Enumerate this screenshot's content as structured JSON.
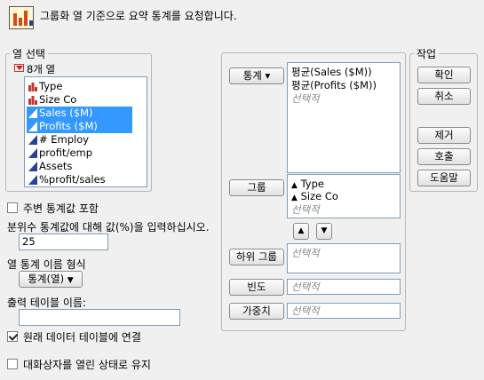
{
  "header": {
    "description": "그룹화 열 기준으로 요약 통계를 요청합니다."
  },
  "column_select": {
    "legend": "열 선택",
    "count_label": "8개 열",
    "items": [
      {
        "label": "Type",
        "icon": "nominal-bar-icon",
        "selected": false
      },
      {
        "label": "Size Co",
        "icon": "nominal-bar-icon",
        "selected": false
      },
      {
        "label": "Sales ($M)",
        "icon": "continuous-triangle-icon",
        "selected": true
      },
      {
        "label": "Profits ($M)",
        "icon": "continuous-triangle-icon",
        "selected": true
      },
      {
        "label": "# Employ",
        "icon": "continuous-triangle-icon",
        "selected": false
      },
      {
        "label": "profit/emp",
        "icon": "continuous-triangle-icon",
        "selected": false
      },
      {
        "label": "Assets",
        "icon": "continuous-triangle-icon",
        "selected": false
      },
      {
        "label": "%profit/sales",
        "icon": "continuous-triangle-icon",
        "selected": false
      }
    ]
  },
  "options": {
    "include_marginal_label": "주변 통계값 포함",
    "include_marginal_checked": false,
    "quantile_label": "분위수 통계값에 대해 값(%)을 입력하십시오.",
    "quantile_value": "25",
    "stat_name_format_label": "열 통계 이름 형식",
    "stat_name_format_value": "통계(열)",
    "output_table_label": "출력 테이블 이름:",
    "output_table_value": "",
    "link_to_original_label": "원래 데이터 테이블에 연결",
    "link_to_original_checked": true,
    "keep_dialog_open_label": "대화상자를 열린 상태로 유지",
    "keep_dialog_open_checked": false
  },
  "roles": {
    "stats_button": "통계 ▾",
    "stats_items": [
      "평균(Sales ($M))",
      "평균(Profits ($M))"
    ],
    "optional_placeholder": "선택적",
    "group_button": "그룹",
    "group_items": [
      "Type",
      "Size Co"
    ],
    "subgroup_button": "하위 그룹",
    "freq_button": "빈도",
    "weight_button": "가중치"
  },
  "actions": {
    "legend": "작업",
    "ok": "확인",
    "cancel": "취소",
    "remove": "제거",
    "recall": "호출",
    "help": "도움말"
  },
  "colors": {
    "selection": "#3399ff",
    "nominal_icon": "#c0392b",
    "continuous_icon": "#2b3f9e"
  }
}
